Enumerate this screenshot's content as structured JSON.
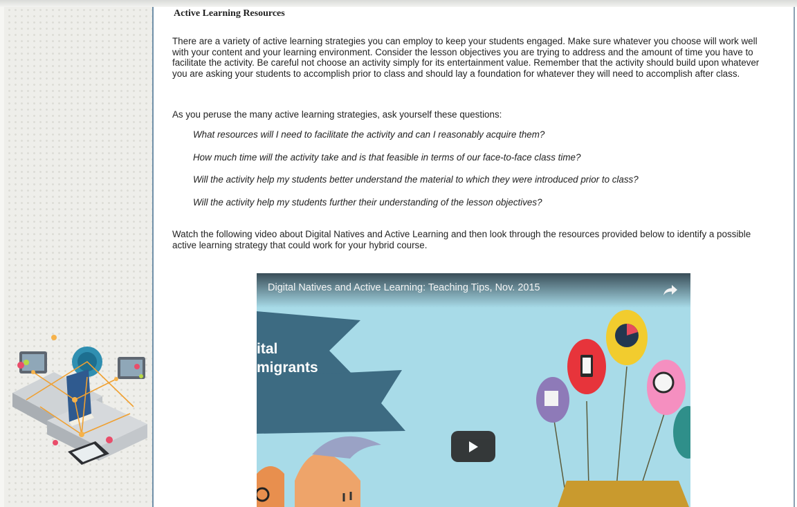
{
  "page": {
    "heading": "Active Learning Resources",
    "intro_paragraph": "There are a variety of active learning strategies you can employ to keep your students engaged. Make sure whatever you choose will work well with your content and your learning environment. Consider the lesson objectives you are trying to address and the amount of time you have to facilitate the activity. Be careful not choose an activity simply for its entertainment value. Remember that the activity should build upon whatever you are asking your students to accomplish prior to class and should lay a foundation for whatever they will need to accomplish after class.",
    "questions_intro": "As you peruse the many active learning strategies, ask yourself these questions:",
    "questions": [
      "What resources will I need to facilitate the activity and can I reasonably acquire them?",
      "How much time will the activity take and is that feasible in terms of our face-to-face class time?",
      "Will the activity help my students better understand the material to which they were introduced prior to class?",
      "Will the activity help my students further their understanding of the lesson objectives?"
    ],
    "video_paragraph": "Watch the following video about Digital Natives and Active Learning and then look through the resources provided below to identify a possible active learning strategy that could work for your hybrid course."
  },
  "video": {
    "title": "Digital Natives and Active Learning: Teaching Tips, Nov. 2015",
    "banner_line1": "ital",
    "banner_line2": "migrants",
    "share_icon": "share-icon",
    "play_icon": "play-icon"
  },
  "colors": {
    "sidebar_border": "#6f8fa8",
    "video_background": "#a8dbe8",
    "banner": "#3d6b82"
  }
}
